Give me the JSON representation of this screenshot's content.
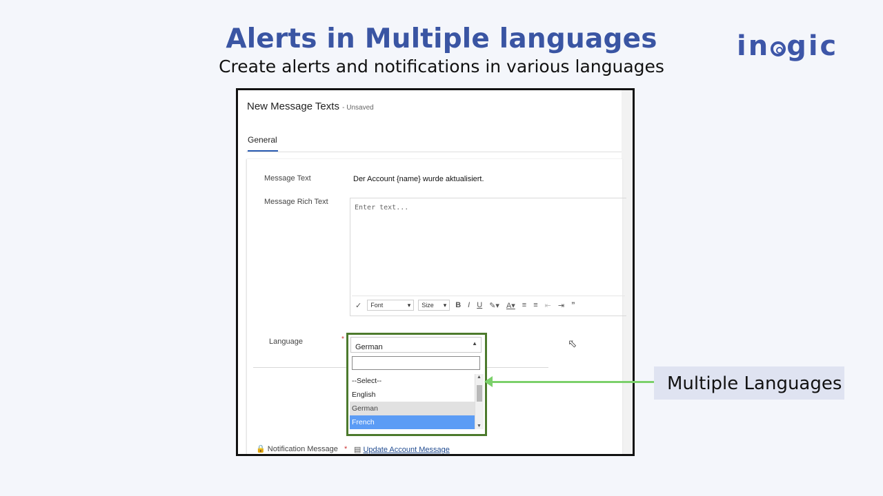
{
  "header": {
    "title": "Alerts in Multiple languages",
    "subtitle": "Create alerts and notifications in various languages",
    "logo": "inogic"
  },
  "form": {
    "title": "New Message Texts",
    "status": "- Unsaved",
    "tab_general": "General",
    "message_text_label": "Message Text",
    "message_text_value": "Der Account {name} wurde aktualisiert.",
    "rich_text_label": "Message Rich Text",
    "rich_text_placeholder": "Enter text...",
    "toolbar": {
      "font": "Font",
      "size": "Size",
      "bold": "B",
      "italic": "I",
      "underline": "U",
      "quote": "”"
    },
    "language_label": "Language",
    "language_value": "German",
    "language_options": [
      "--Select--",
      "English",
      "German",
      "French"
    ],
    "notification_label": "Notification Message",
    "notification_value": "Update Account Message"
  },
  "callout": {
    "label": "Multiple Languages"
  },
  "colors": {
    "title": "#3a55a3",
    "dropdown_border": "#4c7a2c",
    "selected_option": "#5b9cf5",
    "arrow": "#7bd06a",
    "callout_bg": "#dfe3f1"
  }
}
